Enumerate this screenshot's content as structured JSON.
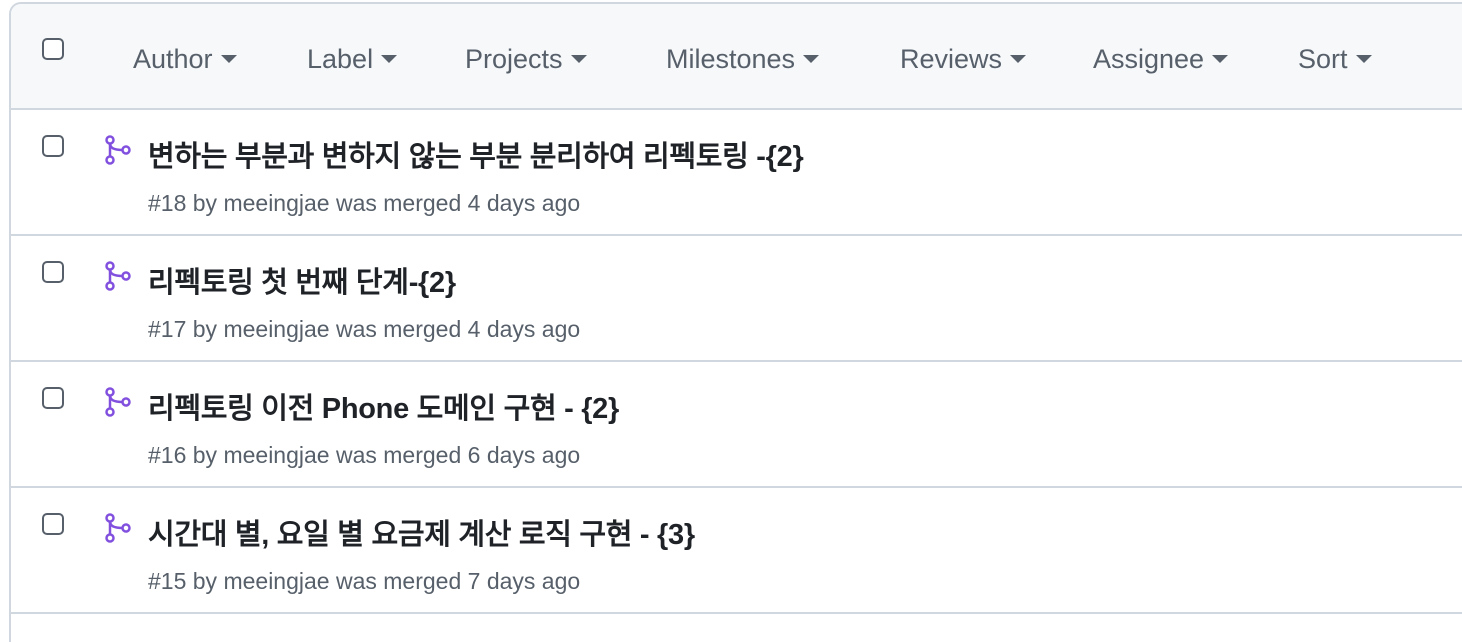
{
  "filters": {
    "author": "Author",
    "label": "Label",
    "projects": "Projects",
    "milestones": "Milestones",
    "reviews": "Reviews",
    "assignee": "Assignee",
    "sort": "Sort"
  },
  "pulls": [
    {
      "title": "변하는 부분과 변하지 않는 부분 분리하여 리펙토링 -{2}",
      "number": "#18",
      "by": "by",
      "author": "meeingjae",
      "status": "was merged 4 days ago"
    },
    {
      "title": "리펙토링 첫 번째 단계-{2}",
      "number": "#17",
      "by": "by",
      "author": "meeingjae",
      "status": "was merged 4 days ago"
    },
    {
      "title": "리펙토링 이전 Phone 도메인 구현 - {2}",
      "number": "#16",
      "by": "by",
      "author": "meeingjae",
      "status": "was merged 6 days ago"
    },
    {
      "title": "시간대 별, 요일 별 요금제 계산 로직 구현 - {3}",
      "number": "#15",
      "by": "by",
      "author": "meeingjae",
      "status": "was merged 7 days ago"
    }
  ],
  "icons": {
    "pr_merged": "git-merge-icon",
    "caret": "triangle-down-icon"
  },
  "colors": {
    "merged_purple": "#8250df",
    "text_primary": "#1f2328",
    "text_muted": "#57606a",
    "border": "#d0d7de",
    "toolbar_bg": "#f6f8fa"
  }
}
